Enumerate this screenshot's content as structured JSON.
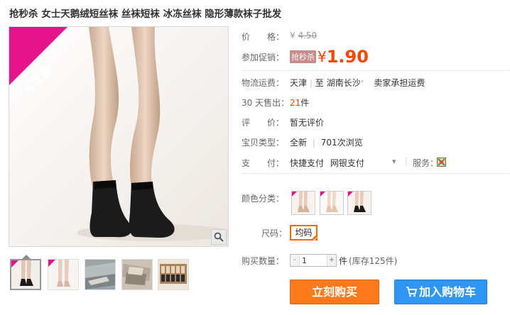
{
  "product": {
    "title": "抢秒杀 女士天鹅绒短丝袜 丝袜短袜 冰冻丝袜 隐形薄款袜子批发",
    "badge": "6双装"
  },
  "price": {
    "label": "价　　格：",
    "yen": "¥",
    "value": "4.50"
  },
  "promo": {
    "label": "参加促销：",
    "tag": "抢秒杀",
    "yen": "¥",
    "value": "1.90"
  },
  "shipping": {
    "label": "物流运费：",
    "from": "天津",
    "separator": "|",
    "to_prefix": "至",
    "to": "湖南长沙",
    "arrow": "˅",
    "note": "卖家承担运费"
  },
  "sales": {
    "label": "30 天售出：",
    "count": "21",
    "unit": "件"
  },
  "review": {
    "label": "评　　价：",
    "value": "暂无评价"
  },
  "item_type": {
    "label": "宝贝类型：",
    "condition": "全新",
    "separator": "|",
    "views": "701次浏览"
  },
  "payment": {
    "label": "支　　付：",
    "method1": "快捷支付",
    "method2": "网银支付",
    "arrow": "▾",
    "service_label": "服务："
  },
  "color": {
    "label": "颜色分类：",
    "options": [
      "nude",
      "skin",
      "black"
    ]
  },
  "size": {
    "label": "尺码：",
    "selected": "均码"
  },
  "quantity": {
    "label": "购买数量：",
    "value": "1",
    "minus": "-",
    "plus": "+",
    "unit": "件",
    "stock": "(库存125件)"
  },
  "actions": {
    "buy_now": "立刻购买",
    "add_to_cart": "加入购物车"
  },
  "colors": {
    "accent": "#ff4400",
    "buy": "#ff7a1a",
    "cart": "#2f96f5",
    "badge": "#e6148a"
  },
  "icons": {
    "zoom": "magnifier-icon",
    "cart": "cart-icon",
    "service": "service-icon"
  }
}
